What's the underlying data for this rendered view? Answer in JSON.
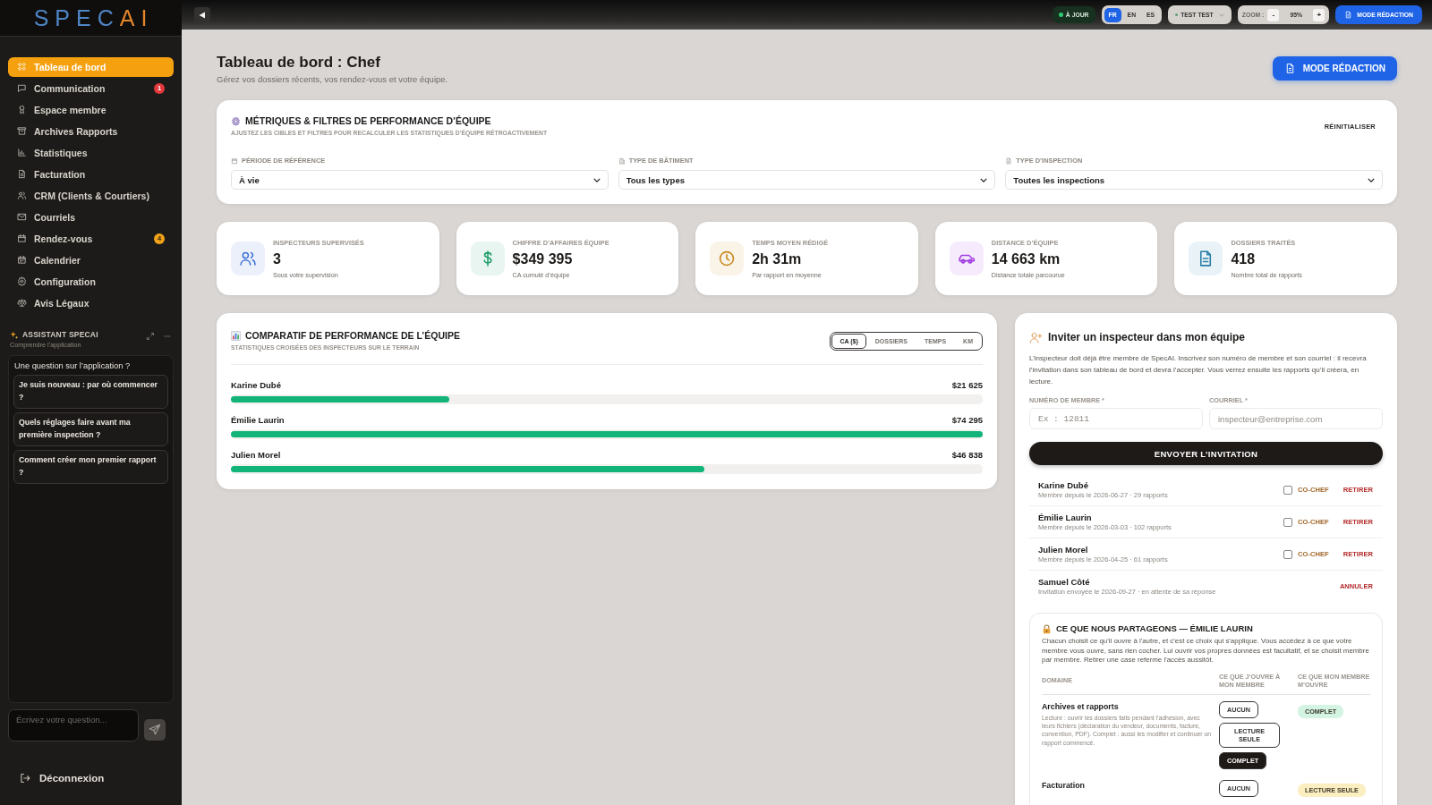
{
  "sidebar": {
    "logo": {
      "main": "SPEC",
      "accent": "AI"
    },
    "nav": [
      {
        "label": "Tableau de bord",
        "kind": "dashboard",
        "selected": true
      },
      {
        "label": "Communication",
        "kind": "messages",
        "selected": false,
        "badge": {
          "text": "1",
          "color": "#e5383b"
        }
      },
      {
        "label": "Espace membre",
        "kind": "member",
        "selected": false
      },
      {
        "label": "Archives Rapports",
        "kind": "archive",
        "selected": false
      },
      {
        "label": "Statistiques",
        "kind": "stats",
        "selected": false
      },
      {
        "label": "Facturation",
        "kind": "billing",
        "selected": false
      },
      {
        "label": "CRM (Clients & Courtiers)",
        "kind": "crm",
        "selected": false
      },
      {
        "label": "Courriels",
        "kind": "mail",
        "selected": false
      },
      {
        "label": "Rendez-vous",
        "kind": "appointments",
        "selected": false,
        "badge": {
          "text": "4",
          "color": "#f0a21a"
        }
      },
      {
        "label": "Calendrier",
        "kind": "calendar",
        "selected": false
      },
      {
        "label": "Configuration",
        "kind": "settings",
        "selected": false
      },
      {
        "label": "Avis Légaux",
        "kind": "legal",
        "selected": false
      }
    ],
    "assistant": {
      "title": "ASSISTANT SPECAI",
      "subtitle": "Comprendre l’application",
      "prompt": "Une question sur l’application ?",
      "suggestions": [
        "Je suis nouveau : par où commencer ?",
        "Quels réglages faire avant ma première inspection ?",
        "Comment créer mon premier rapport ?"
      ],
      "input": {
        "placeholder": "Écrivez votre question..."
      }
    },
    "logout": "Déconnexion"
  },
  "topbar": {
    "status": "À JOUR",
    "languages": [
      {
        "label": "FR",
        "selected": true
      },
      {
        "label": "EN",
        "selected": false
      },
      {
        "label": "ES",
        "selected": false
      }
    ],
    "user": "TEST TEST",
    "zoom": {
      "label": "ZOOM :",
      "minus": "-",
      "value": "95%",
      "plus": "+"
    },
    "mode_button": "MODE RÉDACTION"
  },
  "header": {
    "title": "Tableau de bord : Chef",
    "subtitle": "Gérez vos dossiers récents, vos rendez-vous et votre équipe.",
    "mode_button": "MODE RÉDACTION"
  },
  "filters": {
    "title": "MÉTRIQUES & FILTRES DE PERFORMANCE D’ÉQUIPE",
    "subtitle": "AJUSTEZ LES CIBLES ET FILTRES POUR RECALCULER LES STATISTIQUES D’ÉQUIPE RÉTROACTIVEMENT",
    "reset": "RÉINITIALISER",
    "fields": [
      {
        "kind": "period",
        "label": "PÉRIODE DE RÉFÉRENCE",
        "value": "À vie"
      },
      {
        "kind": "building",
        "label": "TYPE DE BÂTIMENT",
        "value": "Tous les types"
      },
      {
        "kind": "inspection",
        "label": "TYPE D’INSPECTION",
        "value": "Toutes les inspections"
      }
    ]
  },
  "kpis": [
    {
      "kind": "inspectors",
      "label": "INSPECTEURS SUPERVISÉS",
      "value": "3",
      "note": "Sous votre supervision"
    },
    {
      "kind": "revenue",
      "label": "CHIFFRE D’AFFAIRES ÉQUIPE",
      "value": "$349 395",
      "note": "CA cumulé d’équipe"
    },
    {
      "kind": "time",
      "label": "TEMPS MOYEN RÉDIGÉ",
      "value": "2h 31m",
      "note": "Par rapport en moyenne"
    },
    {
      "kind": "distance",
      "label": "DISTANCE D’ÉQUIPE",
      "value": "14 663 km",
      "note": "Distance totale parcourue"
    },
    {
      "kind": "files",
      "label": "DOSSIERS TRAITÉS",
      "value": "418",
      "note": "Nombre total de rapports"
    }
  ],
  "performance": {
    "title": "COMPARATIF DE PERFORMANCE DE L’ÉQUIPE",
    "subtitle": "STATISTIQUES CROISÉES DES INSPECTEURS SUR LE TERRAIN",
    "tabs": [
      {
        "label": "CA ($)",
        "selected": true
      },
      {
        "label": "DOSSIERS",
        "selected": false
      },
      {
        "label": "TEMPS",
        "selected": false
      },
      {
        "label": "KM",
        "selected": false
      }
    ],
    "rows": [
      {
        "name": "Karine Dubé",
        "value": "$21 625",
        "level": 0.29
      },
      {
        "name": "Émilie Laurin",
        "value": "$74 295",
        "level": 1.0
      },
      {
        "name": "Julien Morel",
        "value": "$46 838",
        "level": 0.63
      }
    ]
  },
  "invite": {
    "title": "Inviter un inspecteur dans mon équipe",
    "text": "L’inspecteur doit déjà être membre de SpecAI. Inscrivez son numéro de membre et son courriel : il recevra l’invitation dans son tableau de bord et devra l’accepter. Vous verrez ensuite les rapports qu’il créera, en lecture.",
    "fields": [
      {
        "kind": "number",
        "label": "NUMÉRO DE MEMBRE *",
        "placeholder": "Ex : 12811"
      },
      {
        "kind": "email",
        "label": "COURRIEL *",
        "placeholder": "inspecteur@entreprise.com"
      }
    ],
    "submit": "ENVOYER L’INVITATION",
    "members": [
      {
        "kind": "member",
        "name": "Karine Dubé",
        "detail": "Membre depuis le 2026-06-27 · 29 rapports",
        "co_chef": false,
        "co_chef_label": "CO-CHEF",
        "action": "RETIRER"
      },
      {
        "kind": "member",
        "name": "Émilie Laurin",
        "detail": "Membre depuis le 2026-03-03 · 102 rapports",
        "co_chef": false,
        "co_chef_label": "CO-CHEF",
        "action": "RETIRER"
      },
      {
        "kind": "member",
        "name": "Julien Morel",
        "detail": "Membre depuis le 2026-04-25 · 61 rapports",
        "co_chef": false,
        "co_chef_label": "CO-CHEF",
        "action": "RETIRER"
      },
      {
        "kind": "pending",
        "name": "Samuel Côté",
        "detail": "Invitation envoyée le 2026-09-27 · en attente de sa réponse",
        "action": "ANNULER"
      }
    ],
    "sharing": {
      "title": "CE QUE NOUS PARTAGEONS — ÉMILIE LAURIN",
      "text": "Chacun choisit ce qu'il ouvre à l'autre, et c'est ce choix qui s'applique. Vous accédez à ce que votre membre vous ouvre, sans rien cocher. Lui ouvrir vos propres données est facultatif, et se choisit membre par membre. Retirer une case referme l'accès aussitôt.",
      "columns": [
        "DOMAINE",
        "CE QUE J’OUVRE À MON MEMBRE",
        "CE QUE MON MEMBRE M’OUVRE"
      ],
      "rows": [
        {
          "domain": "Archives et rapports",
          "description": "Lecture : ouvrir les dossiers faits pendant l'adhésion, avec leurs fichiers (déclaration du vendeur, documents, facture, convention, PDF). Complet : aussi les modifier et continuer un rapport commencé.",
          "options": [
            {
              "label": "AUCUN",
              "selected": false
            },
            {
              "label": "LECTURE SEULE",
              "selected": false
            },
            {
              "label": "COMPLET",
              "selected": true
            }
          ],
          "received": {
            "text": "COMPLET",
            "color": "#d3f3e3"
          }
        },
        {
          "domain": "Facturation",
          "options": [
            {
              "label": "AUCUN",
              "selected": false
            }
          ],
          "received": {
            "text": "LECTURE SEULE",
            "color": "#fbeec0"
          }
        }
      ]
    }
  }
}
